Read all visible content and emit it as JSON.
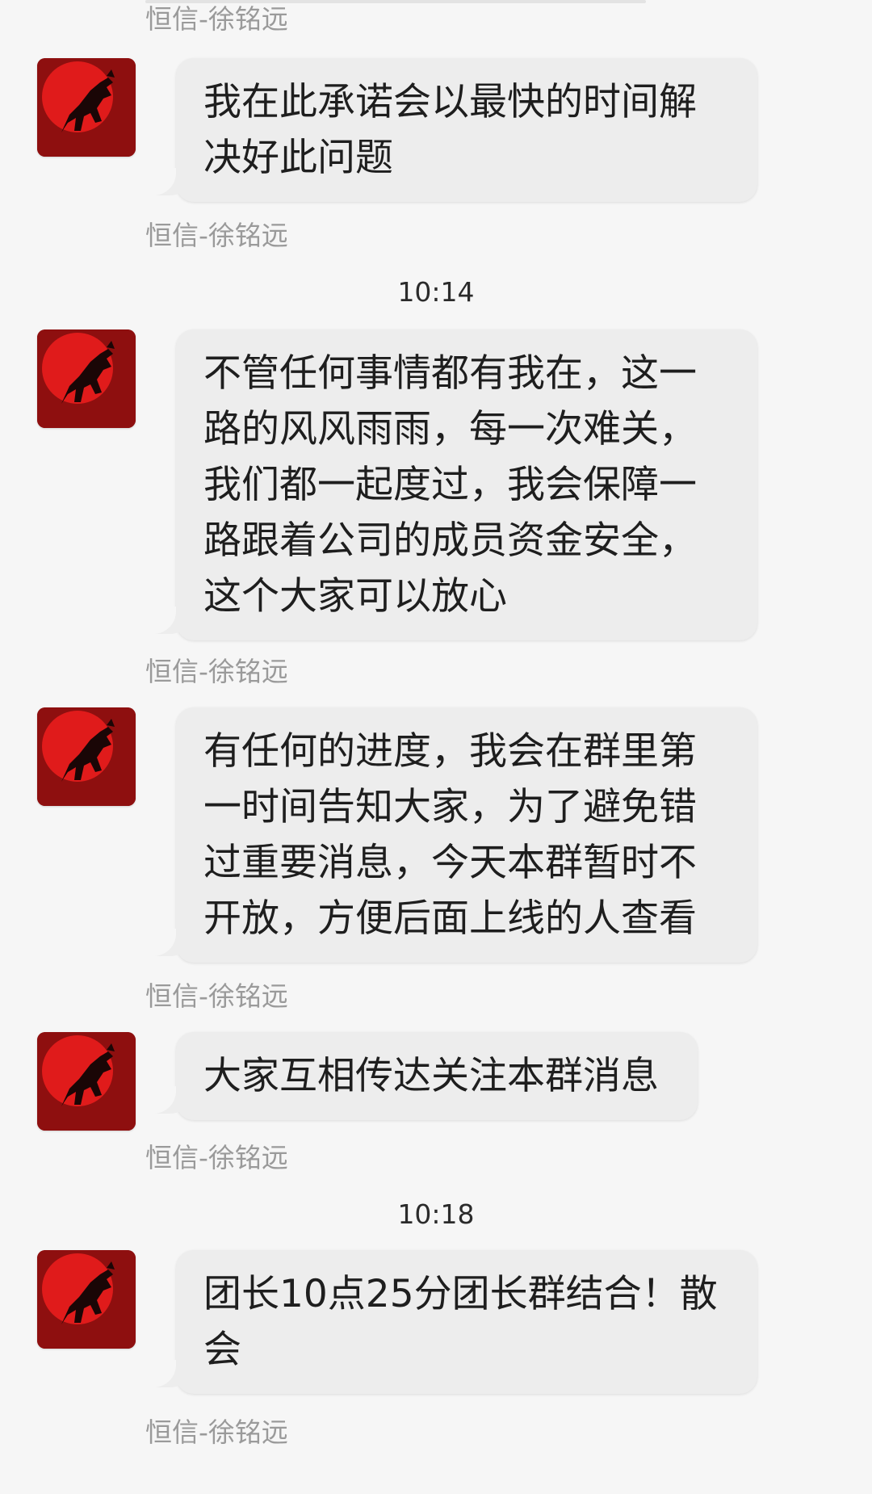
{
  "sender_name": "恒信-徐铭远",
  "avatar": {
    "icon": "red-sun-black-horse-icon",
    "bg_color": "#8e0f0f",
    "sun_color": "#e01b1b",
    "horse_color": "#1a0606"
  },
  "colors": {
    "background": "#f6f6f6",
    "bubble": "#ededed",
    "sender_text": "#9a9a9a"
  },
  "timestamps": [
    "10:14",
    "10:18"
  ],
  "messages": [
    {
      "sender": "恒信-徐铭远",
      "text": "我在此承诺会以最快的时间解决好此问题"
    },
    {
      "sender": "恒信-徐铭远",
      "text": "不管任何事情都有我在，这一路的风风雨雨，每一次难关，我们都一起度过，我会保障一路跟着公司的成员资金安全，这个大家可以放心"
    },
    {
      "sender": "恒信-徐铭远",
      "text": "有任何的进度，我会在群里第一时间告知大家，为了避免错过重要消息，今天本群暂时不开放，方便后面上线的人查看"
    },
    {
      "sender": "恒信-徐铭远",
      "text": "大家互相传达关注本群消息"
    },
    {
      "sender": "恒信-徐铭远",
      "text": "团长10点25分团长群结合！散会"
    }
  ]
}
